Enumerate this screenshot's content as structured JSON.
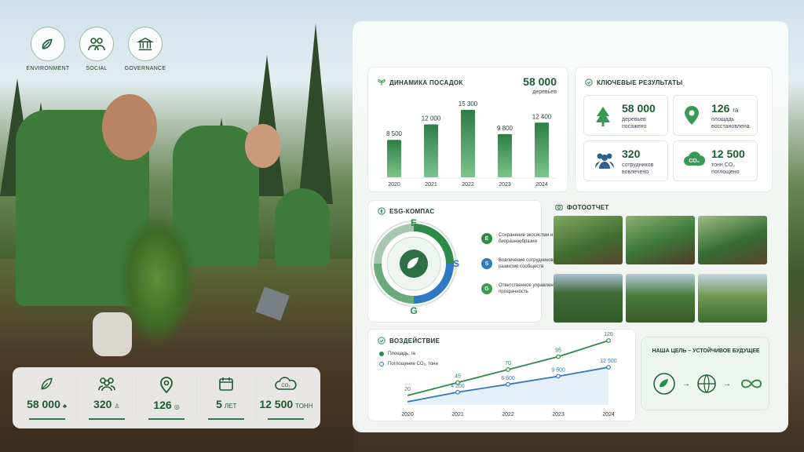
{
  "esg_icons": [
    {
      "label": "ENVIRONMENT",
      "icon": "leaf-hand-icon"
    },
    {
      "label": "SOCIAL",
      "icon": "people-icon"
    },
    {
      "label": "GOVERNANCE",
      "icon": "building-icon"
    }
  ],
  "stats_bar": [
    {
      "value": "58 000",
      "unit": "",
      "icon": "leaf-icon",
      "suffix_icon": "tree-small-icon"
    },
    {
      "value": "320",
      "unit": "",
      "icon": "people-icon",
      "suffix_icon": "person-small-icon"
    },
    {
      "value": "126",
      "unit": "",
      "icon": "location-icon",
      "suffix_icon": "location-small-icon"
    },
    {
      "value": "5",
      "unit": "ЛЕТ",
      "icon": "calendar-icon",
      "suffix_icon": ""
    },
    {
      "value": "12 500",
      "unit": "ТОНН",
      "icon": "co2-icon",
      "suffix_icon": ""
    }
  ],
  "dynamics": {
    "title": "ДИНАМИКА ПОСАДОК",
    "total": "58 000",
    "total_unit": "деревьев"
  },
  "chart_data": [
    {
      "type": "bar",
      "categories": [
        "2020",
        "2021",
        "2022",
        "2023",
        "2024"
      ],
      "values": [
        8500,
        12000,
        15300,
        9800,
        12400
      ],
      "value_labels": [
        "8 500",
        "12 000",
        "15 300",
        "9 800",
        "12 400"
      ],
      "title": "ДИНАМИКА ПОСАДОК"
    },
    {
      "type": "line",
      "title": "ВОЗДЕЙСТВИЕ",
      "categories": [
        "2020",
        "2021",
        "2022",
        "2023",
        "2024"
      ],
      "series": [
        {
          "name": "Площадь, га",
          "values": [
            20,
            45,
            70,
            95,
            126
          ],
          "labels": [
            "20",
            "45",
            "70",
            "95",
            "126"
          ],
          "color": "#2e8b47"
        },
        {
          "name": "Поглощение CO₂, тонн",
          "values": [
            1000,
            4200,
            6800,
            9500,
            12500
          ],
          "labels": [
            "",
            "4 200",
            "6 800",
            "9 500",
            "12 500"
          ],
          "color": "#2f78c4"
        }
      ]
    }
  ],
  "key_results": {
    "title": "КЛЮЧЕВЫЕ РЕЗУЛЬТАТЫ",
    "items": [
      {
        "value": "58 000",
        "desc": "деревьев посажено",
        "icon": "tree-icon"
      },
      {
        "value": "126",
        "unit": "га",
        "desc": "площадь восстановлена",
        "icon": "location-icon"
      },
      {
        "value": "320",
        "desc": "сотрудников вовлечено",
        "icon": "people-icon"
      },
      {
        "value": "12 500",
        "desc": "тонн CO₂ поглощено",
        "icon": "co2-cloud-icon"
      }
    ]
  },
  "compass": {
    "title": "ESG-КОМПАС",
    "letters": [
      "E",
      "S",
      "G"
    ],
    "items": [
      {
        "letter": "E",
        "text": "Сохранение экосистем и биоразнообразия",
        "color": "#2e8b47"
      },
      {
        "letter": "S",
        "text": "Вовлечение сотрудников и развитие сообществ",
        "color": "#2f78c4"
      },
      {
        "letter": "G",
        "text": "Ответственное управление и прозрачность",
        "color": "#3f9a4f"
      }
    ]
  },
  "photos": {
    "title": "ФОТООТЧЕТ"
  },
  "impact": {
    "title": "ВОЗДЕЙСТВИЕ"
  },
  "goal": {
    "title": "НАША ЦЕЛЬ – УСТОЙЧИВОЕ БУДУЩЕЕ"
  }
}
